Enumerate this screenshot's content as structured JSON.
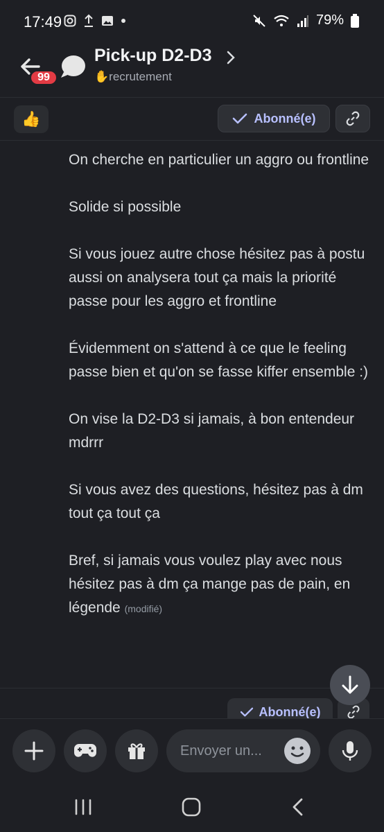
{
  "status": {
    "time": "17:49",
    "battery": "79%"
  },
  "header": {
    "unread": "99",
    "title": "Pick-up D2-D3",
    "subtitle": "✋recrutement"
  },
  "toolbar": {
    "reaction": "👍",
    "follow_label": "Abonné(e)"
  },
  "message": {
    "paragraphs": [
      "On cherche en particulier un aggro ou frontline",
      "Solide si possible",
      "Si vous jouez autre chose hésitez pas à postu aussi on analysera tout ça mais la priorité passe pour les aggro et frontline",
      "Évidemment on s'attend à ce que le feeling passe bien et qu'on se fasse kiffer ensemble :)",
      "On vise la D2-D3 si jamais, à bon entendeur mdrrr",
      "Si vous avez des questions, hésitez pas à dm tout ça tout ça",
      "Bref, si jamais vous voulez play avec nous hésitez pas à dm ça mange pas de pain, en légende"
    ],
    "edited": "(modifié)"
  },
  "footer_follow": {
    "label": "Abonné(e)"
  },
  "composer": {
    "placeholder": "Envoyer un..."
  },
  "colors": {
    "background": "#1e1f24",
    "accent": "#b8c0ff",
    "badge": "#e33b44"
  }
}
